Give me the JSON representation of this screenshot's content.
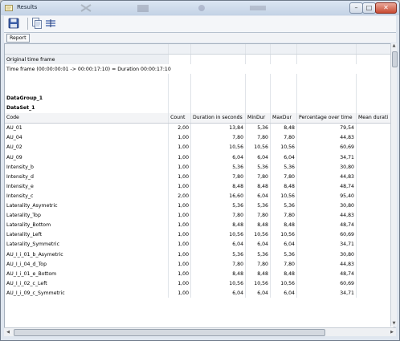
{
  "window": {
    "title": "Results"
  },
  "toolbar": {
    "icons": [
      "save-icon",
      "copy-icon",
      "columns-icon"
    ]
  },
  "tabs": {
    "report_label": "Report"
  },
  "report": {
    "original_time_frame_label": "Original time frame",
    "time_frame_text": "Time frame (00:00:00:01 -> 00:00:17:10) = Duration 00:00:17:10",
    "datagroup_label": "DataGroup_1",
    "dataset_label": "DataSet_1",
    "columns": [
      "Code",
      "Count",
      "Duration in seconds",
      "MinDur",
      "MaxDur",
      "Percentage over time",
      "Mean durati"
    ],
    "rows": [
      [
        "AU_01",
        "2,00",
        "13,84",
        "5,36",
        "8,48",
        "79,54"
      ],
      [
        "AU_04",
        "1,00",
        "7,80",
        "7,80",
        "7,80",
        "44,83"
      ],
      [
        "AU_02",
        "1,00",
        "10,56",
        "10,56",
        "10,56",
        "60,69"
      ],
      [
        "AU_09",
        "1,00",
        "6,04",
        "6,04",
        "6,04",
        "34,71"
      ],
      [
        "Intensity_b",
        "1,00",
        "5,36",
        "5,36",
        "5,36",
        "30,80"
      ],
      [
        "Intensity_d",
        "1,00",
        "7,80",
        "7,80",
        "7,80",
        "44,83"
      ],
      [
        "Intensity_e",
        "1,00",
        "8,48",
        "8,48",
        "8,48",
        "48,74"
      ],
      [
        "Intensity_c",
        "2,00",
        "16,60",
        "6,04",
        "10,56",
        "95,40"
      ],
      [
        "Laterality_Asymetric",
        "1,00",
        "5,36",
        "5,36",
        "5,36",
        "30,80"
      ],
      [
        "Laterality_Top",
        "1,00",
        "7,80",
        "7,80",
        "7,80",
        "44,83"
      ],
      [
        "Laterality_Bottom",
        "1,00",
        "8,48",
        "8,48",
        "8,48",
        "48,74"
      ],
      [
        "Laterality_Left",
        "1,00",
        "10,56",
        "10,56",
        "10,56",
        "60,69"
      ],
      [
        "Laterality_Symmetric",
        "1,00",
        "6,04",
        "6,04",
        "6,04",
        "34,71"
      ],
      [
        "AU_I_i_01_b_Asymetric",
        "1,00",
        "5,36",
        "5,36",
        "5,36",
        "30,80"
      ],
      [
        "AU_I_i_04_d_Top",
        "1,00",
        "7,80",
        "7,80",
        "7,80",
        "44,83"
      ],
      [
        "AU_I_i_01_e_Bottom",
        "1,00",
        "8,48",
        "8,48",
        "8,48",
        "48,74"
      ],
      [
        "AU_I_i_02_c_Left",
        "1,00",
        "10,56",
        "10,56",
        "10,56",
        "60,69"
      ],
      [
        "AU_I_i_09_c_Symmetric",
        "1,00",
        "6,04",
        "6,04",
        "6,04",
        "34,71"
      ]
    ]
  },
  "colors": {
    "titlebar": "#c3d2e5",
    "close_button": "#c84a32",
    "header_row": "#eef1f5"
  }
}
